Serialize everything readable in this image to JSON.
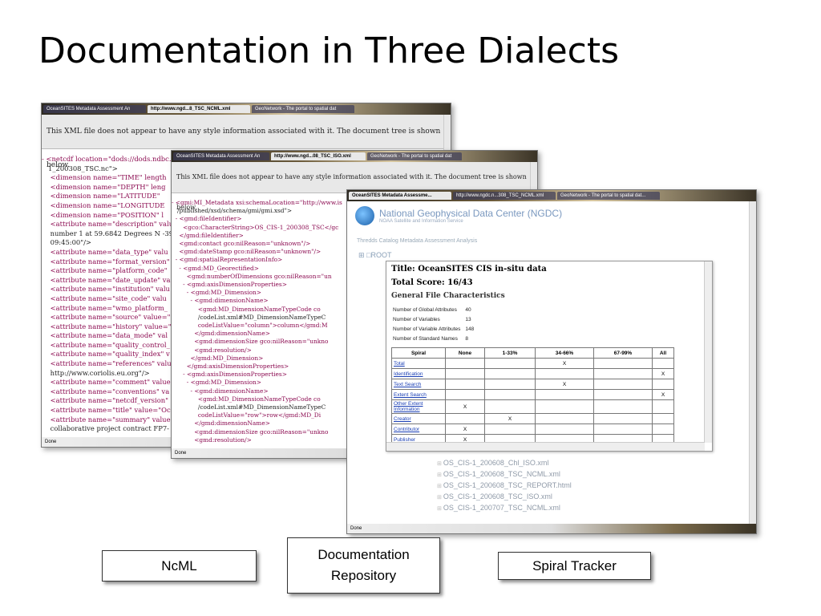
{
  "slide": {
    "title": "Documentation in Three Dialects"
  },
  "window1": {
    "tabs": [
      "OceanSITES Metadata Assessment An",
      "http://www.ngd...8_TSC_NCML.xml",
      "GeoNetwork - The portal to spatial dat"
    ],
    "info_text": "This XML file does not appear to have any style information associated with it. The document tree is shown below.",
    "xml_lines": [
      "- <netcdf location=\"dods://dods.ndbc.n",
      "   1_200308_TSC.nc\">",
      "    <dimension name=\"TIME\" length",
      "    <dimension name=\"DEPTH\" leng",
      "    <dimension name=\"LATITUDE\"",
      "    <dimension name=\"LONGITUDE",
      "    <dimension name=\"POSITION\" l",
      "    <attribute name=\"description\" valu",
      "    number 1 at 59.6842 Degrees N -39",
      "    09:45:00\"/>",
      "    <attribute name=\"data_type\" valu",
      "    <attribute name=\"format_version\"",
      "    <attribute name=\"platform_code\"",
      "    <attribute name=\"date_update\" va",
      "    <attribute name=\"institution\" valu",
      "    <attribute name=\"site_code\" valu",
      "    <attribute name=\"wmo_platform_",
      "    <attribute name=\"source\" value=\"",
      "    <attribute name=\"history\" value=\"",
      "    <attribute name=\"data_mode\" val",
      "    <attribute name=\"quality_control_",
      "    <attribute name=\"quality_index\" v",
      "    <attribute name=\"references\" valu",
      "    http://www.coriolis.eu.org\"/>",
      "    <attribute name=\"comment\" value",
      "    <attribute name=\"conventions\" va",
      "    <attribute name=\"netcdf_version\"",
      "    <attribute name=\"title\" value=\"Oc",
      "    <attribute name=\"summary\" value",
      "    collaborative project contract FP7-"
    ],
    "status": "Done"
  },
  "window2": {
    "tabs": [
      "OceanSITES Metadata Assessment An",
      "http://www.ngd...08_TSC_ISO.xml",
      "GeoNetwork - The portal to spatial dat"
    ],
    "info_text": "This XML file does not appear to have any style information associated with it. The document tree is shown below.",
    "xml_lines": [
      "- <gmi:MI_Metadata xsi:schemaLocation=\"http://www.is",
      "   /published/xsd/schema/gmi/gmi.xsd\">",
      "  - <gmd:fileIdentifier>",
      "      <gco:CharacterString>OS_CIS-1_200308_TSC</gc",
      "    </gmd:fileIdentifier>",
      "    <gmd:contact gco:nilReason=\"unknown\"/>",
      "    <gmd:dateStamp gco:nilReason=\"unknown\"/>",
      "  - <gmd:spatialRepresentationInfo>",
      "    - <gmd:MD_Georectified>",
      "        <gmd:numberOfDimensions gco:nilReason=\"un",
      "      - <gmd:axisDimensionProperties>",
      "        - <gmd:MD_Dimension>",
      "          - <gmd:dimensionName>",
      "              <gmd:MD_DimensionNameTypeCode co",
      "              /codeList.xml#MD_DimensionNameTypeC",
      "              codeListValue=\"column\">column</gmd:M",
      "            </gmd:dimensionName>",
      "            <gmd:dimensionSize gco:nilReason=\"unkno",
      "            <gmd:resolution/>",
      "          </gmd:MD_Dimension>",
      "        </gmd:axisDimensionProperties>",
      "      - <gmd:axisDimensionProperties>",
      "        - <gmd:MD_Dimension>",
      "          - <gmd:dimensionName>",
      "              <gmd:MD_DimensionNameTypeCode co",
      "              /codeList.xml#MD_DimensionNameTypeC",
      "              codeListValue=\"row\">row</gmd:MD_Di",
      "            </gmd:dimensionName>",
      "            <gmd:dimensionSize gco:nilReason=\"unkno",
      "            <gmd:resolution/>"
    ],
    "status": "Done"
  },
  "window3": {
    "tabs": [
      "OceanSITES Metadata Assessme...",
      "http://www.ngdc.n...308_TSC_NCML.xml",
      "GeoNetwork - The portal to spatial dat..."
    ],
    "org_name": "National Geophysical Data Center (NGDC)",
    "org_sub": "NOAA Satellite and Information Service",
    "analysis_label": "Thredds Catalog Metadata Assessment Analysis",
    "root_label": "ROOT",
    "popup": {
      "title": "Title: OceanSITES CIS in-situ data",
      "score": "Total Score: 16/43",
      "section": "General File Characteristics",
      "stats": [
        {
          "label": "Number of Global Attributes",
          "value": "40"
        },
        {
          "label": "Number of Variables",
          "value": "13"
        },
        {
          "label": "Number of Variable Attributes",
          "value": "148"
        },
        {
          "label": "Number of Standard Names",
          "value": "8"
        }
      ],
      "columns": [
        "Spiral",
        "None",
        "1-33%",
        "34-66%",
        "67-99%",
        "All"
      ],
      "rows": [
        {
          "name": "Total",
          "marks": [
            "",
            "",
            "X",
            "",
            ""
          ]
        },
        {
          "name": "Identification",
          "marks": [
            "",
            "",
            "",
            "",
            "X"
          ]
        },
        {
          "name": "Text Search",
          "marks": [
            "",
            "",
            "X",
            "",
            ""
          ]
        },
        {
          "name": "Extent Search",
          "marks": [
            "",
            "",
            "",
            "",
            "X"
          ]
        },
        {
          "name": "Other Extent Information",
          "marks": [
            "X",
            "",
            "",
            "",
            ""
          ]
        },
        {
          "name": "Creator",
          "marks": [
            "",
            "X",
            "",
            "",
            ""
          ]
        },
        {
          "name": "Contributor",
          "marks": [
            "X",
            "",
            "",
            "",
            ""
          ]
        },
        {
          "name": "Publisher",
          "marks": [
            "X",
            "",
            "",
            "",
            ""
          ]
        }
      ]
    },
    "files": [
      "OS_CIS-1_200608_Chl_ISO.xml",
      "OS_CIS-1_200608_TSC_NCML.xml",
      "OS_CIS-1_200608_TSC_REPORT.html",
      "OS_CIS-1_200608_TSC_ISO.xml",
      "OS_CIS-1_200707_TSC_NCML.xml"
    ],
    "status": "Done"
  },
  "labels": {
    "ncml": "NcML",
    "repository": "Documentation Repository",
    "spiral": "Spiral Tracker"
  }
}
